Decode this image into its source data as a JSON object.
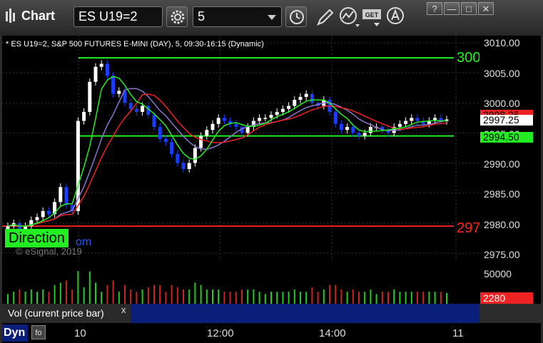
{
  "toolbar": {
    "title": "Chart",
    "symbol": "ES U19=2",
    "interval": "5",
    "window_buttons": [
      "?",
      "—",
      "□",
      "✕"
    ]
  },
  "chart": {
    "description": "* ES U19=2, S&P 500 FUTURES E-MINI (DAY), 5, 09:30-16:15 (Dynamic)",
    "watermark": "© eSignal, 2019",
    "direction_label": "Direction",
    "direction_tail": "om",
    "level_top_label": "300",
    "level_bottom_label": "297",
    "price_ticks": [
      "3010.00",
      "3005.00",
      "3000.00",
      "2995.00",
      "2990.00",
      "2985.00",
      "2980.00",
      "2975.00"
    ],
    "price_tags": {
      "red": "2998.25",
      "white": "2997.25",
      "green": "2994.50"
    },
    "colors": {
      "up": "#ffffff",
      "down": "#1a3cff",
      "green_line": "#22ee22",
      "red_line": "#ee2222"
    }
  },
  "volume": {
    "panel_label": "Vol (current price bar)",
    "close_glyph": "x",
    "tick": "50000",
    "current": "2280"
  },
  "time_axis": {
    "labels": [
      "10",
      "12:00",
      "14:00",
      "11"
    ]
  },
  "bottom": {
    "dyn_label": "Dyn",
    "dyn_icon": "fo"
  },
  "chart_data": {
    "type": "candlestick",
    "ylim": [
      2975,
      3010
    ],
    "price_ticks": [
      3010,
      3005,
      3000,
      2995,
      2990,
      2985,
      2980,
      2975
    ],
    "time_labels": [
      "10",
      "12:00",
      "14:00",
      "11"
    ],
    "horizontal_levels": [
      {
        "price": 3007.5,
        "color": "green"
      },
      {
        "price": 2994.5,
        "color": "green"
      },
      {
        "price": 2979.5,
        "color": "red"
      }
    ],
    "closes": [
      2979.5,
      2980.0,
      2979.0,
      2979.5,
      2980.5,
      2981.0,
      2982.0,
      2981.5,
      2983.5,
      2986.0,
      2983.0,
      2982.0,
      2997.0,
      2998.5,
      3003.5,
      3006.0,
      3006.5,
      3004.5,
      3001.5,
      3002.0,
      3000.0,
      2999.0,
      2998.5,
      2999.5,
      2998.0,
      2996.0,
      2994.0,
      2993.5,
      2991.5,
      2990.0,
      2989.0,
      2990.0,
      2992.5,
      2994.5,
      2995.5,
      2996.5,
      2997.5,
      2997.0,
      2996.5,
      2996.0,
      2995.0,
      2996.0,
      2997.0,
      2997.5,
      2997.5,
      2998.0,
      2998.5,
      2999.0,
      2999.5,
      3000.5,
      3001.0,
      3001.5,
      3000.0,
      2999.5,
      3000.5,
      2998.5,
      2996.5,
      2995.5,
      2996.0,
      2995.0,
      2994.5,
      2995.0,
      2996.0,
      2996.0,
      2995.5,
      2995.0,
      2996.0,
      2996.5,
      2997.0,
      2997.5,
      2997.0,
      2996.5,
      2997.0,
      2997.5,
      2997.0,
      2997.25
    ],
    "volume_ticks": [
      50000
    ]
  }
}
